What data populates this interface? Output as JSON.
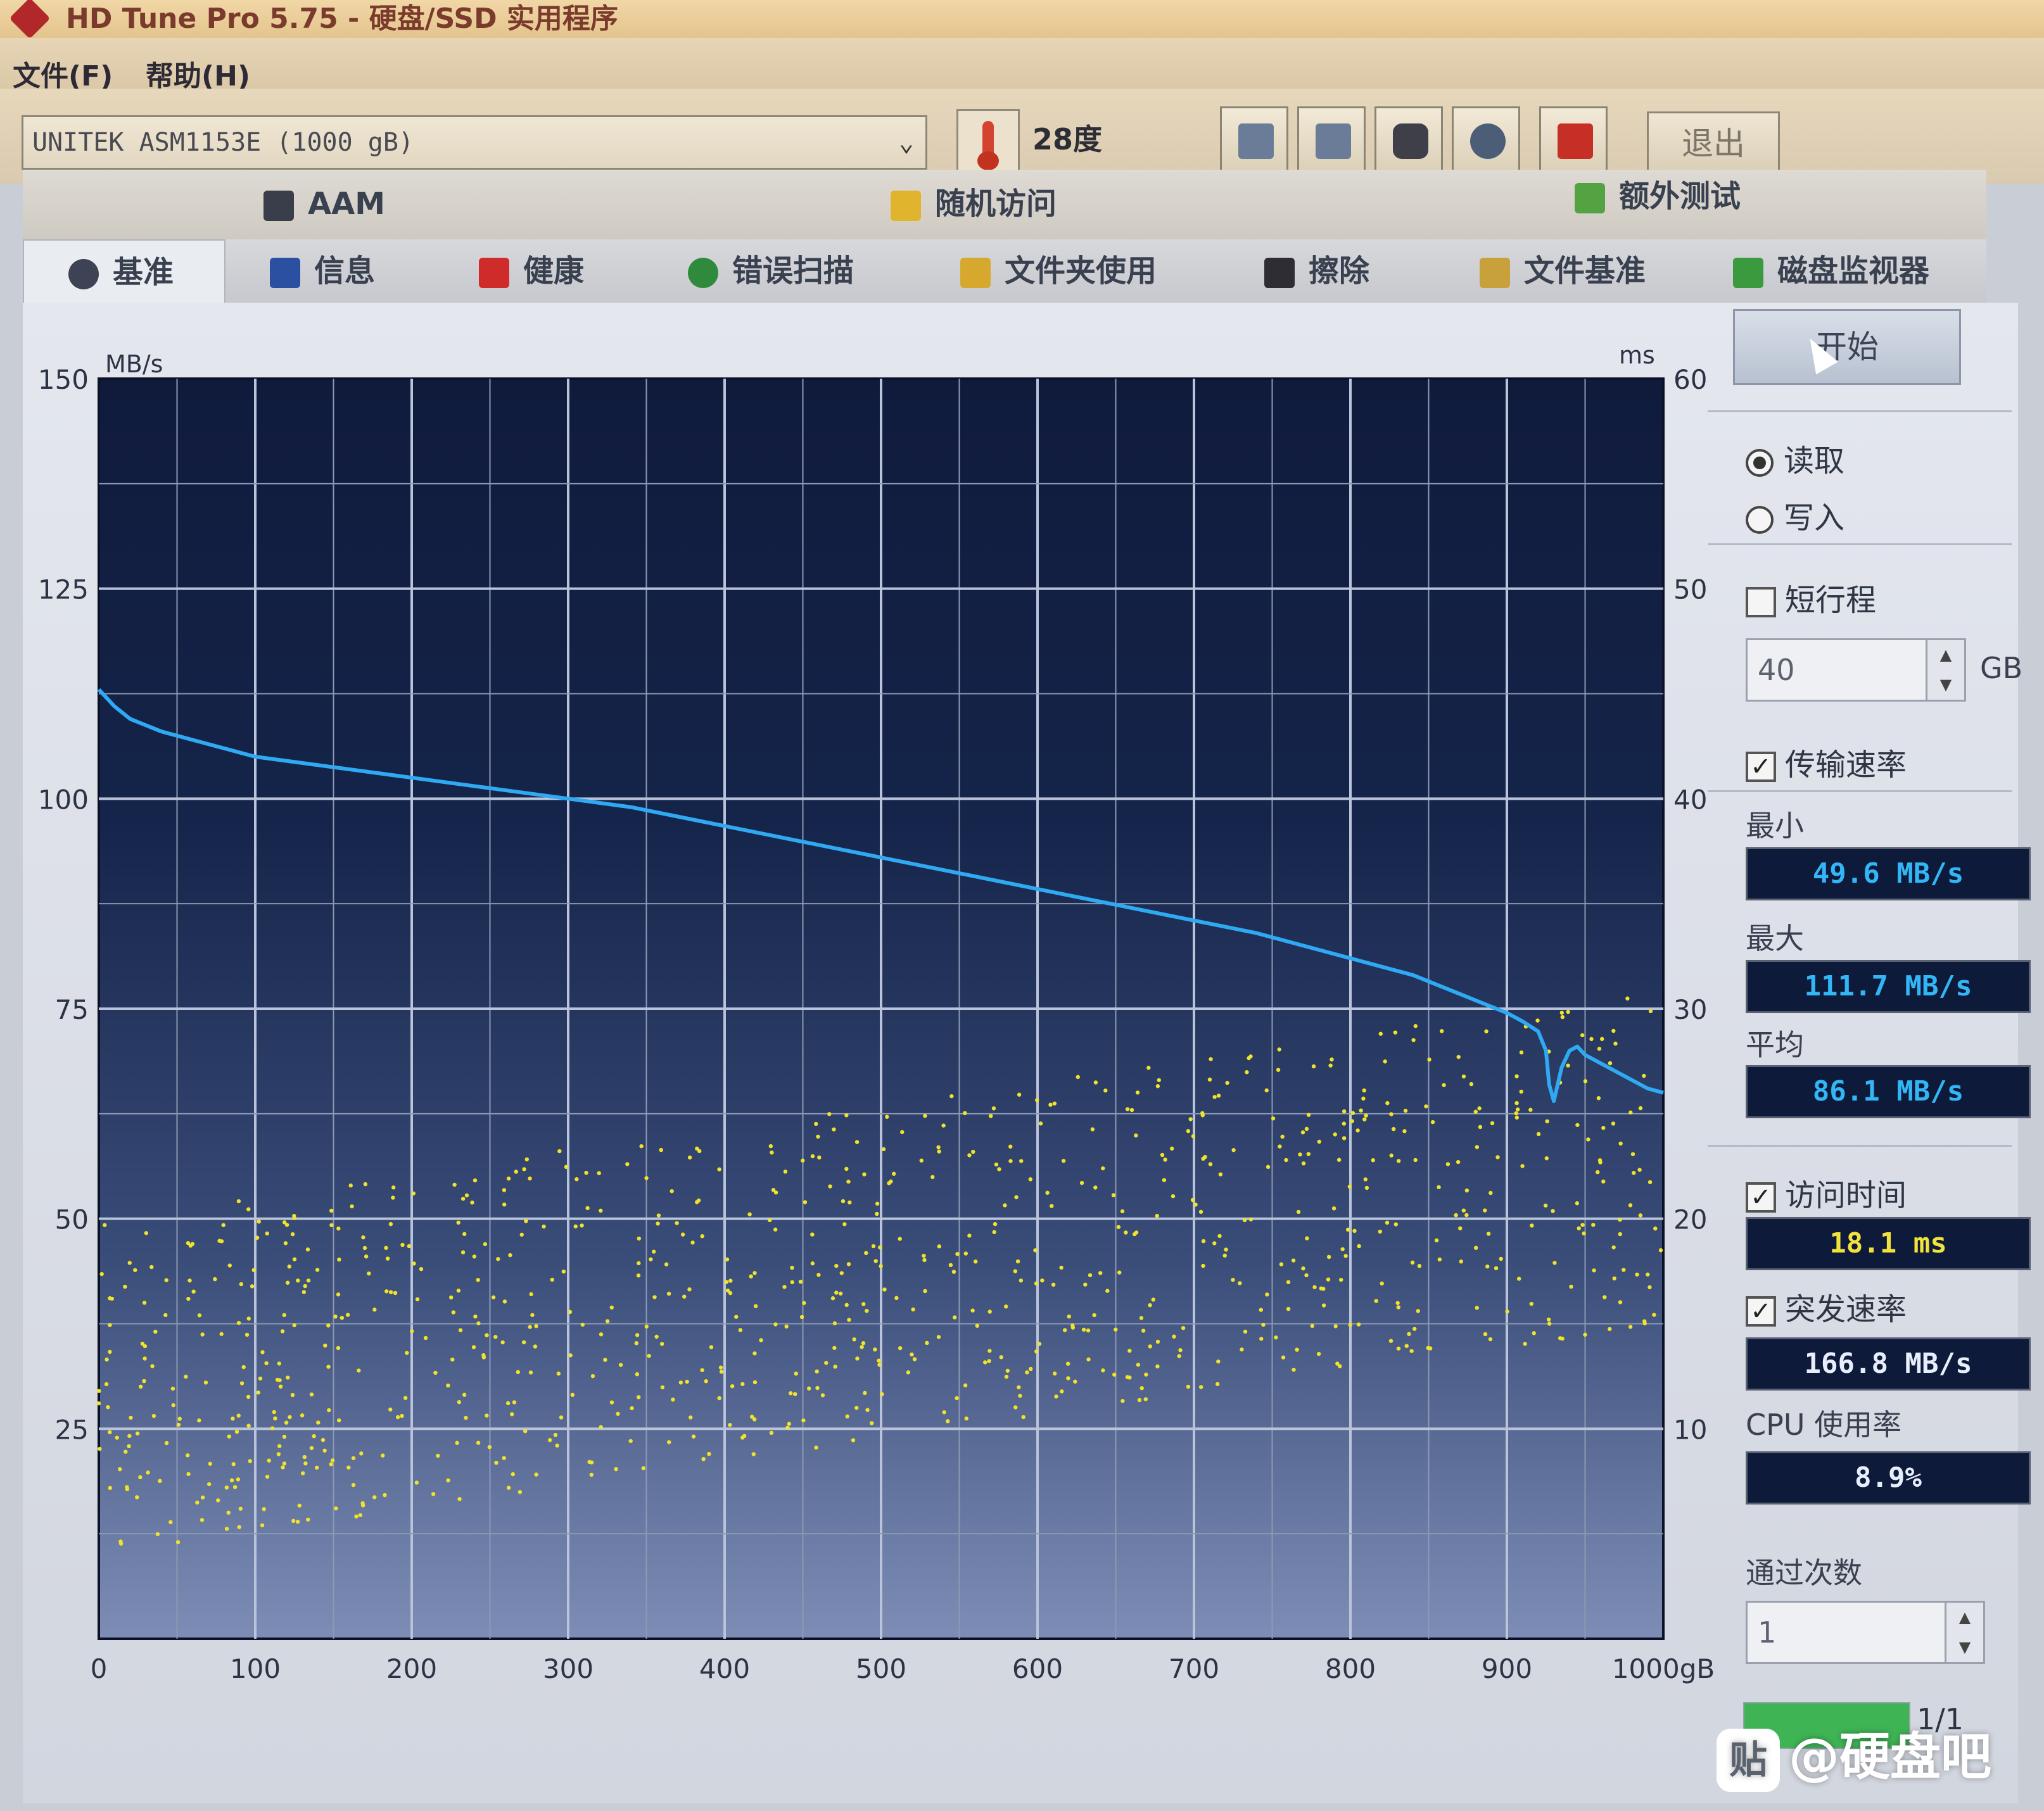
{
  "window": {
    "title": "HD Tune Pro 5.75 - 硬盘/SSD 实用程序"
  },
  "menu": {
    "items": [
      {
        "label": "文件(F)"
      },
      {
        "label": "帮助(H)"
      }
    ]
  },
  "toolbar": {
    "drive": "UNITEK  ASM1153E (1000 gB)",
    "temperature": "28度",
    "exit_label": "退出",
    "buttons": [
      {
        "icon": "copy-info-icon",
        "color": "#6a7c98"
      },
      {
        "icon": "copy-text-icon",
        "color": "#6a7c98"
      },
      {
        "icon": "camera-icon",
        "color": "#3f3f49"
      },
      {
        "icon": "options-icon",
        "color": "#4b5d77"
      },
      {
        "icon": "save-icon",
        "color": "#c62f25"
      }
    ]
  },
  "tabs": {
    "top": [
      {
        "label": "AAM",
        "icon": "aam-icon",
        "color": "#3a3e4a"
      },
      {
        "label": "随机访问",
        "icon": "random-access-icon",
        "color": "#e0b42c"
      },
      {
        "label": "额外测试",
        "icon": "extra-tests-icon",
        "color": "#54a342"
      }
    ],
    "bottom": [
      {
        "label": "基准",
        "icon": "benchmark-icon",
        "color": "#3d4254",
        "active": true
      },
      {
        "label": "信息",
        "icon": "info-icon",
        "color": "#2b4fa1"
      },
      {
        "label": "健康",
        "icon": "health-icon",
        "color": "#d02b2b"
      },
      {
        "label": "错误扫描",
        "icon": "error-scan-icon",
        "color": "#2f8a3b"
      },
      {
        "label": "文件夹使用",
        "icon": "folder-usage-icon",
        "color": "#d6a92e"
      },
      {
        "label": "擦除",
        "icon": "erase-icon",
        "color": "#2d2d33"
      },
      {
        "label": "文件基准",
        "icon": "file-benchmark-icon",
        "color": "#c8a03c"
      },
      {
        "label": "磁盘监视器",
        "icon": "disk-monitor-icon",
        "color": "#3a9a3d"
      }
    ]
  },
  "side": {
    "start_label": "开始",
    "mode": {
      "read": "读取",
      "write": "写入",
      "selected": "read"
    },
    "short_stroke": {
      "label": "短行程",
      "checked": false,
      "value": "40",
      "unit": "GB"
    },
    "transfer_rate": {
      "label": "传输速率",
      "checked": true
    },
    "min_label": "最小",
    "min_value": "49.6 MB/s",
    "max_label": "最大",
    "max_value": "111.7 MB/s",
    "avg_label": "平均",
    "avg_value": "86.1 MB/s",
    "access_time": {
      "label": "访问时间",
      "checked": true,
      "value": "18.1 ms"
    },
    "burst_rate": {
      "label": "突发速率",
      "checked": true,
      "value": "166.8 MB/s"
    },
    "cpu_label": "CPU 使用率",
    "cpu_value": "8.9%",
    "passes_label": "通过次数",
    "passes_value": "1",
    "progress_text": "1/1",
    "progress_fraction": 1.0,
    "colors": {
      "lcd_blue": "#33b6f5",
      "lcd_yellow": "#f2e23c",
      "lcd_white": "#e9eefc"
    }
  },
  "watermark": {
    "badge": "贴",
    "text": "@硬盘吧"
  },
  "chart_data": {
    "type": "line",
    "left_unit": "MB/s",
    "right_unit": "ms",
    "ylim": [
      0,
      150
    ],
    "y2lim": [
      0,
      60
    ],
    "xlim": [
      0,
      1000
    ],
    "y_ticks": [
      "150",
      "125",
      "100",
      "75",
      "50",
      "25"
    ],
    "y2_ticks": [
      "60",
      "50",
      "40",
      "30",
      "20",
      "10"
    ],
    "x_ticks": [
      "0",
      "100",
      "200",
      "300",
      "400",
      "500",
      "600",
      "700",
      "800",
      "900",
      "1000gB"
    ],
    "grid": true,
    "series": [
      {
        "kind": "transfer_rate",
        "color": "#2fa9f2",
        "points": [
          [
            0,
            113
          ],
          [
            10,
            111
          ],
          [
            20,
            109.5
          ],
          [
            40,
            108
          ],
          [
            60,
            107
          ],
          [
            80,
            106
          ],
          [
            100,
            105
          ],
          [
            140,
            104
          ],
          [
            180,
            103
          ],
          [
            220,
            102
          ],
          [
            260,
            101
          ],
          [
            300,
            100
          ],
          [
            340,
            99
          ],
          [
            380,
            97.5
          ],
          [
            420,
            96
          ],
          [
            460,
            94.5
          ],
          [
            500,
            93
          ],
          [
            540,
            91.5
          ],
          [
            580,
            90
          ],
          [
            620,
            88.5
          ],
          [
            660,
            87
          ],
          [
            700,
            85.5
          ],
          [
            740,
            84
          ],
          [
            760,
            83
          ],
          [
            800,
            81
          ],
          [
            840,
            79
          ],
          [
            860,
            77.5
          ],
          [
            880,
            76
          ],
          [
            900,
            74.5
          ],
          [
            910,
            73.5
          ],
          [
            920,
            72.3
          ],
          [
            925,
            70
          ],
          [
            927,
            66
          ],
          [
            930,
            64
          ],
          [
            935,
            68
          ],
          [
            940,
            70
          ],
          [
            945,
            70.5
          ],
          [
            950,
            69.5
          ],
          [
            960,
            68.5
          ],
          [
            970,
            67.5
          ],
          [
            980,
            66.5
          ],
          [
            990,
            65.5
          ],
          [
            1000,
            65
          ]
        ]
      },
      {
        "kind": "access_time",
        "color": "#f0e32a",
        "scatter": true
      }
    ]
  }
}
